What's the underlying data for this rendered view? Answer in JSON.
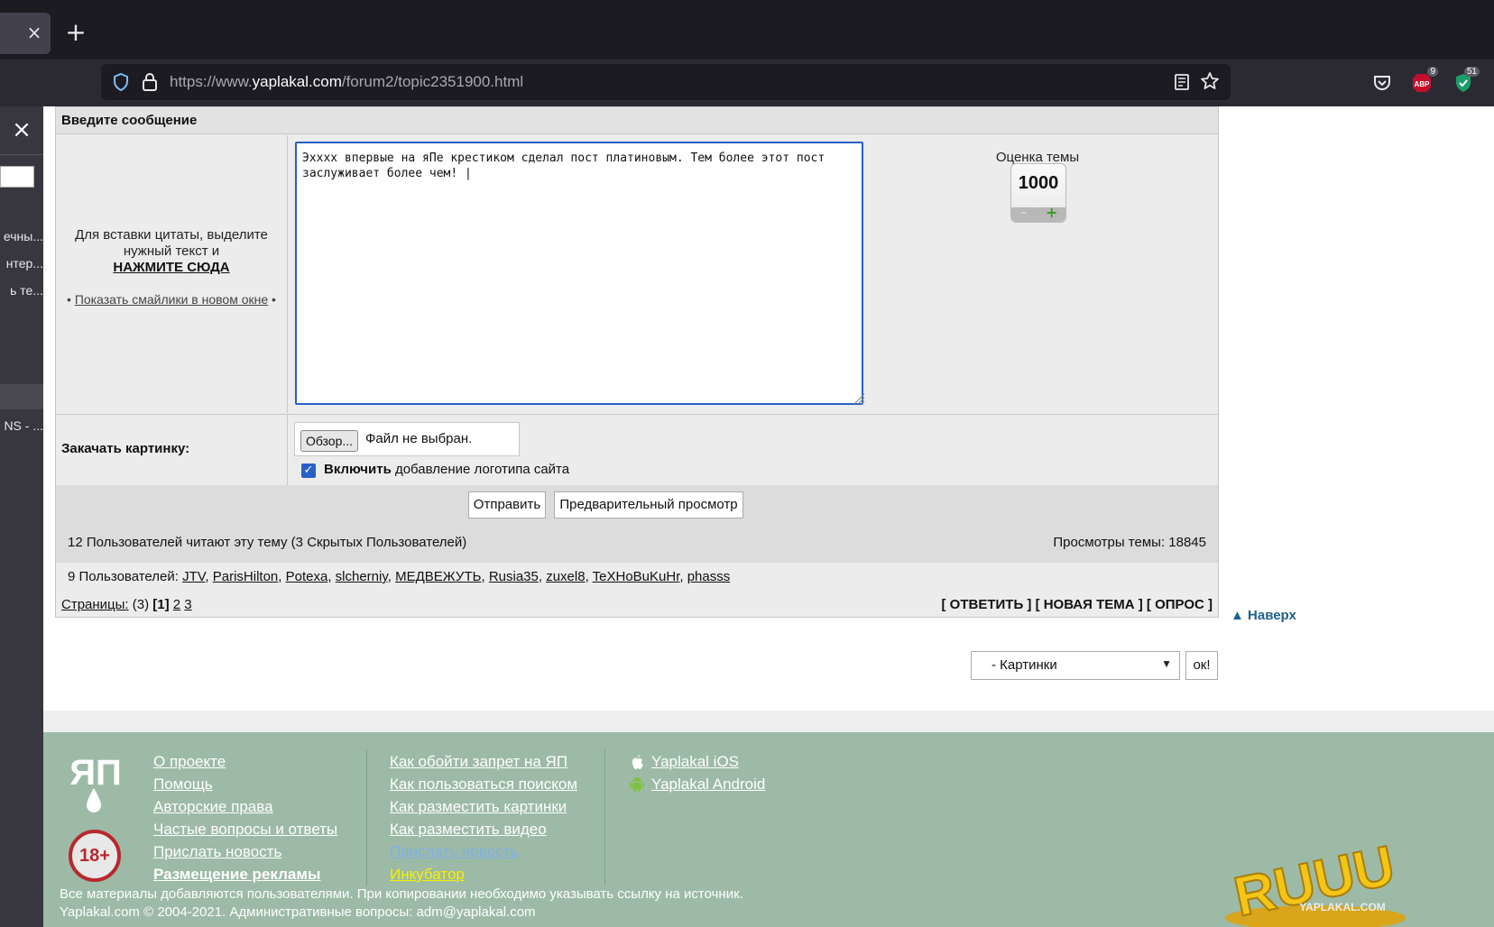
{
  "browser": {
    "tab_close": "×",
    "new_tab": "+",
    "url_prefix": "https://www.",
    "url_domain": "yaplakal.com",
    "url_path": "/forum2/topic2351900.html",
    "abp_badge": "9",
    "ext_badge": "51"
  },
  "sidebar": {
    "close": "×",
    "items": [
      "ечны...",
      "нтер...",
      "ь те...",
      "NS - ..."
    ]
  },
  "form": {
    "header": "Введите сообщение",
    "quote_text": "Для вставки цитаты, выделите нужный текст и",
    "quote_link": "НАЖМИТЕ СЮДА",
    "smiles_prefix": "• ",
    "smiles_link": "Показать смайлики в новом окне",
    "smiles_suffix": " •",
    "message": "Эхххх впервые на яПе крестиком сделал пост платиновым. Тем более этот пост\nзаслуживает более чем! |",
    "rating_label": "Оценка темы",
    "rating_value": "1000",
    "rating_minus": "–",
    "rating_plus": "+",
    "upload_label": "Закачать картинку:",
    "browse": "Обзор...",
    "no_file": "Файл не выбран.",
    "checkbox_mark": "✓",
    "logo_bold": "Включить",
    "logo_rest": " добавление логотипа сайта",
    "submit": "Отправить",
    "preview": "Предварительный просмотр"
  },
  "stats": {
    "readers": "12 Пользователей читают эту тему (3 Скрытых Пользователей)",
    "views": "Просмотры темы: 18845",
    "users_prefix": "9 Пользователей: ",
    "users": [
      "JTV",
      "ParisHilton",
      "Potexa",
      "slcherniy",
      "МЕДВЕЖУТЬ",
      "Rusia35",
      "zuxel8",
      "TeXHoBuKuHr",
      "phasss"
    ]
  },
  "pagination": {
    "label": "Страницы:",
    "total": " (3) ",
    "current": "[1]",
    "p2": "2",
    "p3": "3"
  },
  "actions": "[ ОТВЕТИТЬ ] [ НОВАЯ ТЕМА ] [ ОПРОС ]",
  "totop": "Наверх",
  "jump": {
    "selected": "- Картинки",
    "ok": "ок!"
  },
  "footer": {
    "logo": "ЯП",
    "age": "18+",
    "col1": [
      "О проекте",
      "Помощь",
      "Авторские права",
      "Частые вопросы и ответы",
      "Прислать новость",
      "Размещение рекламы"
    ],
    "col2": [
      "Как обойти запрет на ЯП",
      "Как пользоваться поиском",
      "Как разместить картинки",
      "Как разместить видео",
      "Прислать новость",
      "Инкубатор"
    ],
    "apps": [
      "Yaplakal iOS",
      "Yaplakal Android"
    ],
    "copy1": "Все материалы добавляются пользователями. При копировании необходимо указывать ссылку на источник.",
    "copy2": "Yaplakal.com © 2004-2021. Административные вопросы: adm@yaplakal.com",
    "ruuu": "RUUU",
    "ruuu_site": "YAPLAKAL.COM"
  },
  "colors": {
    "accent": "#2860c7",
    "footer_bg": "#9dbaa6",
    "link_top": "#1e5f8a",
    "incubator": "#f7f100"
  }
}
